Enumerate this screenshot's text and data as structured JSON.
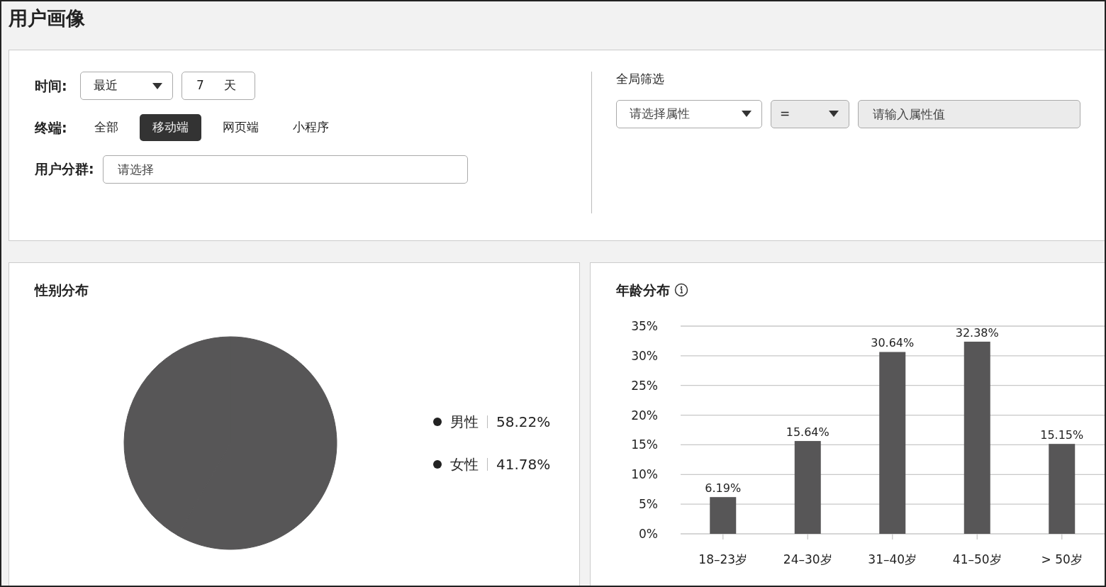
{
  "page": {
    "title": "用户画像"
  },
  "filters": {
    "time": {
      "label": "时间:",
      "mode": "最近",
      "count": "7",
      "unit": "天"
    },
    "terminal": {
      "label": "终端:",
      "options": [
        {
          "label": "全部",
          "selected": false
        },
        {
          "label": "移动端",
          "selected": true
        },
        {
          "label": "网页端",
          "selected": false
        },
        {
          "label": "小程序",
          "selected": false
        }
      ]
    },
    "segment": {
      "label": "用户分群:",
      "placeholder": "请选择"
    },
    "global": {
      "title": "全局筛选",
      "attribute": {
        "placeholder": "请选择属性"
      },
      "operator": {
        "value": "=",
        "disabled": true
      },
      "value": {
        "placeholder": "请输入属性值",
        "disabled": true
      }
    }
  },
  "gender": {
    "title": "性别分布",
    "chart_data": {
      "type": "pie",
      "categories": [
        "男性",
        "女性"
      ],
      "series": [
        {
          "color": "#575657",
          "values": [
            58.22,
            41.78
          ]
        }
      ],
      "value_labels": [
        "58.22%",
        "41.78%"
      ]
    }
  },
  "age": {
    "title": "年龄分布",
    "chart_data": {
      "type": "bar",
      "categories": [
        "18–23岁",
        "24–30岁",
        "31–40岁",
        "41–50岁",
        "> 50岁"
      ],
      "series": [
        {
          "color": "#575657",
          "values": [
            6.19,
            15.64,
            30.64,
            32.38,
            15.15
          ]
        }
      ],
      "ylim": [
        0,
        35
      ],
      "grid": true,
      "yticks": [
        {
          "value": 0,
          "label": "0%"
        },
        {
          "value": 5,
          "label": "5%"
        },
        {
          "value": 10,
          "label": "10%"
        },
        {
          "value": 15,
          "label": "15%"
        },
        {
          "value": 20,
          "label": "20%"
        },
        {
          "value": 25,
          "label": "25%"
        },
        {
          "value": 30,
          "label": "30%"
        },
        {
          "value": 35,
          "label": "35%"
        }
      ],
      "value_labels": [
        "6.19%",
        "15.64%",
        "30.64%",
        "32.38%",
        "15.15%"
      ]
    }
  }
}
